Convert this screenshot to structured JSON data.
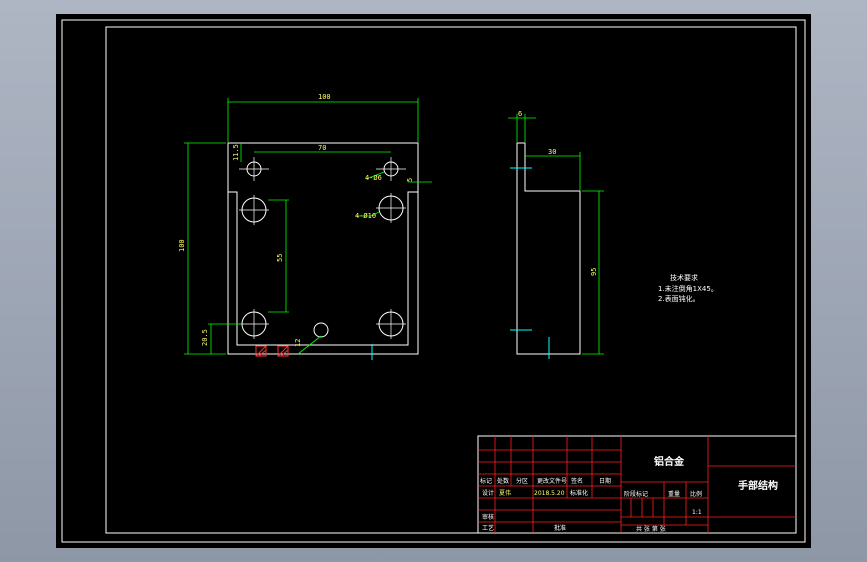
{
  "drawing": {
    "colors": {
      "background": "#000000",
      "outline": "#ffffff",
      "dimension": "#00ff00",
      "dimension_text": "#ffff66",
      "title_block": "#ff2020",
      "center_mark": "#00ffff"
    },
    "front_view": {
      "dim_width_top": "100",
      "dim_hole_spacing_h": "70",
      "dim_height": "100",
      "dim_hole_spacing_v": "55",
      "dim_top_offset": "11.5",
      "dim_bottom_offset": "20.5",
      "dim_hole_small": "4-Ø6",
      "dim_hole_large": "4-Ø10",
      "dim_right_offset": "5",
      "dim_bottom_small": "12"
    },
    "side_view": {
      "dim_thickness": "6",
      "dim_flange": "30",
      "dim_height": "95"
    },
    "notes": {
      "heading": "技术要求",
      "line1": "1.未注倒角1X45。",
      "line2": "2.表面钝化。"
    },
    "title_block": {
      "material": "铝合金",
      "part_name": "手部结构",
      "row_labels": [
        "标记",
        "处数",
        "分区",
        "更改文件号",
        "签名",
        "日期"
      ],
      "designer_label": "设计",
      "designer_name": "夏伟",
      "design_date": "2018.5.20",
      "standard_label": "标准化",
      "stage_label": "阶段标记",
      "weight_label": "重量",
      "scale_label": "比例",
      "scale_value": "1:1",
      "review_label": "审核",
      "process_label": "工艺",
      "approve_label": "批准",
      "sheet_info": "共  张  第  张"
    }
  }
}
